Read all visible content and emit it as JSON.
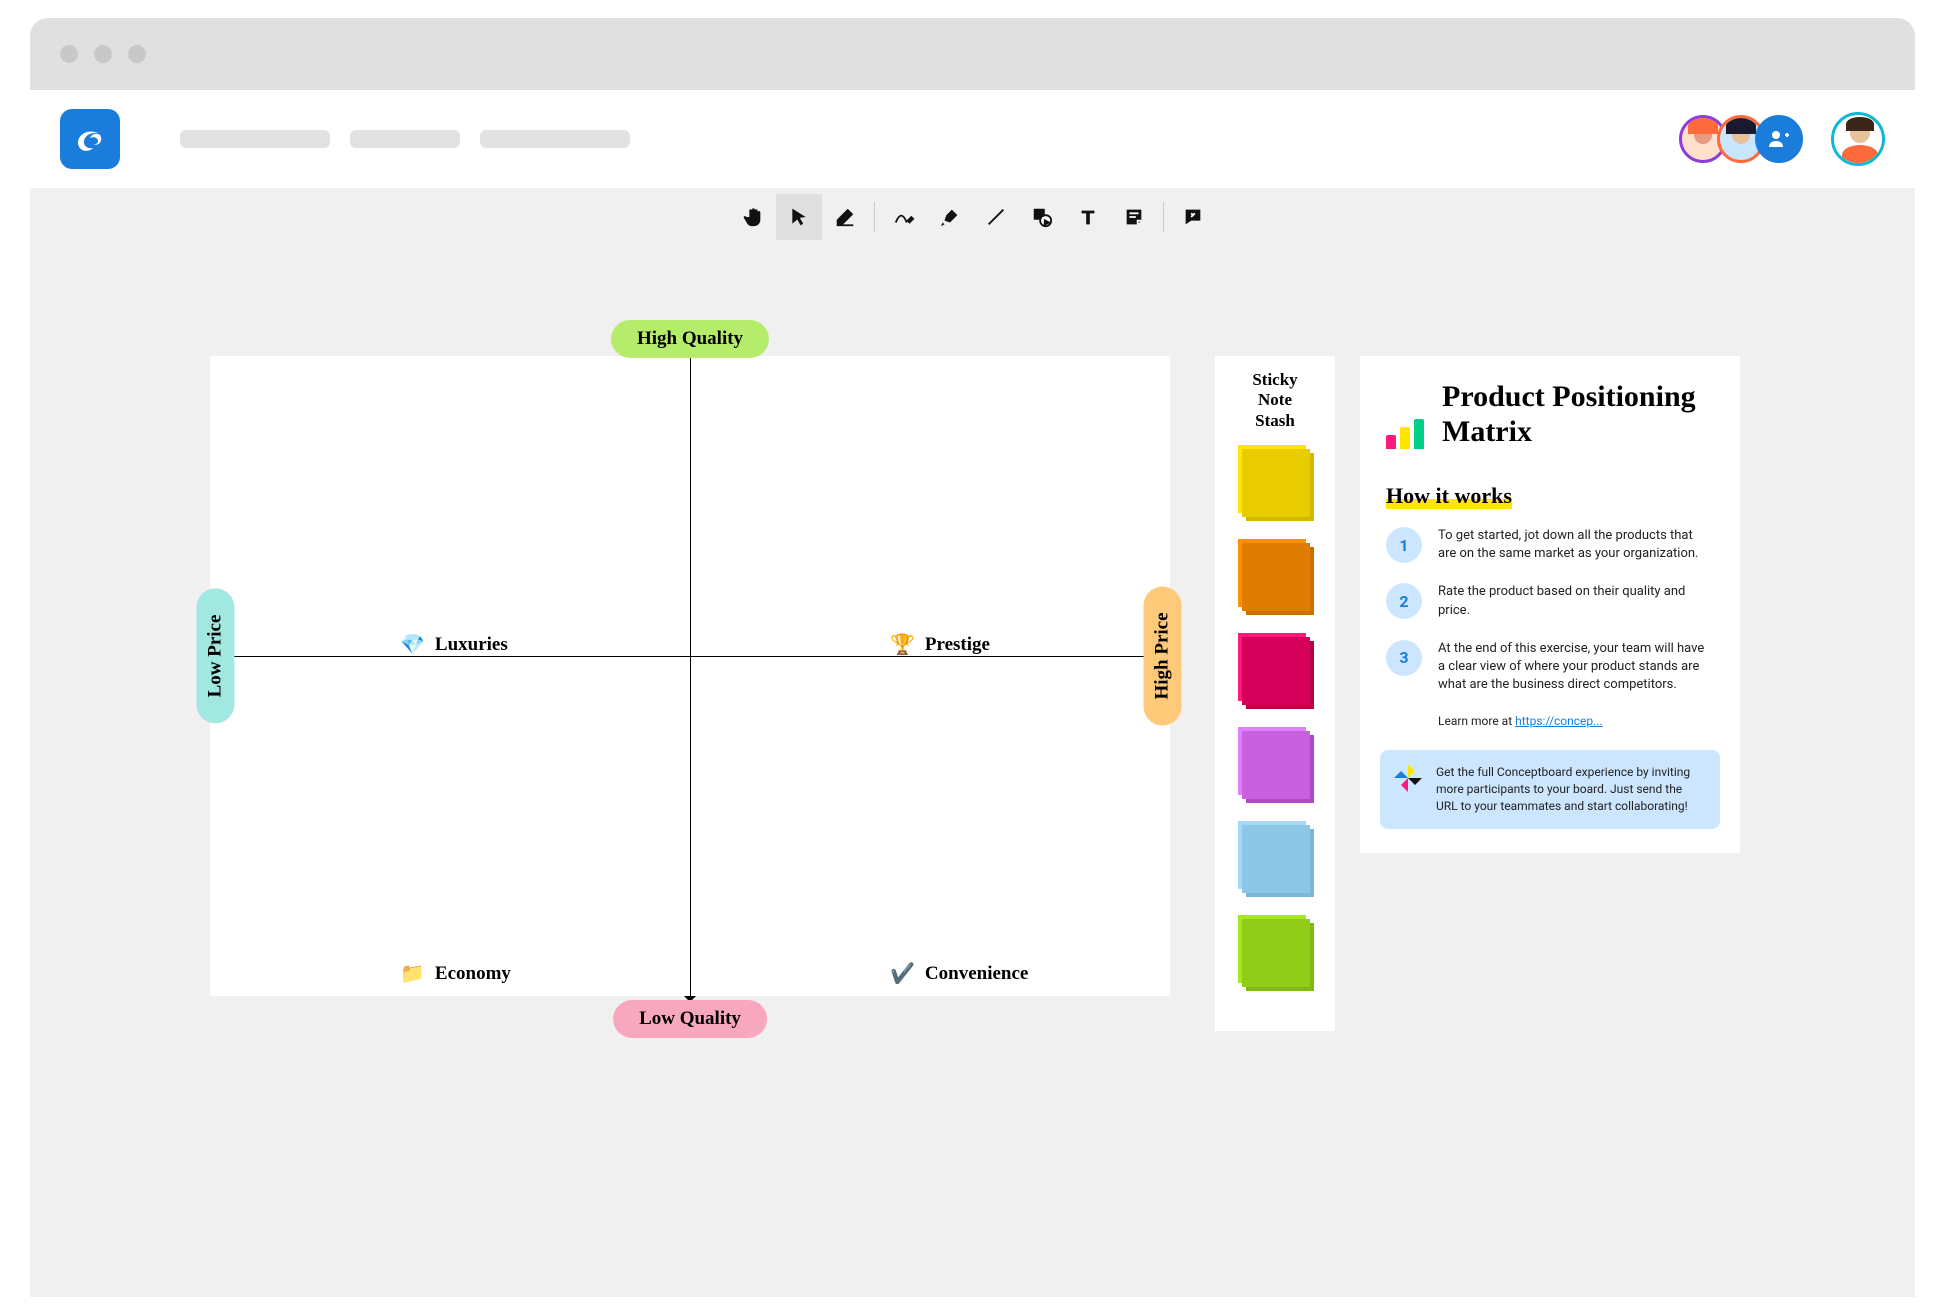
{
  "matrix": {
    "axis_top": "High Quality",
    "axis_bottom": "Low Quality",
    "axis_left": "Low Price",
    "axis_right": "High Price",
    "quadrants": {
      "top_left": {
        "icon": "💎",
        "label": "Luxuries"
      },
      "top_right": {
        "icon": "🏆",
        "label": "Prestige"
      },
      "bottom_left": {
        "icon": "📁",
        "label": "Economy"
      },
      "bottom_right": {
        "icon": "✔️",
        "label": "Convenience"
      }
    }
  },
  "sticky": {
    "title_l1": "Sticky",
    "title_l2": "Note",
    "title_l3": "Stash"
  },
  "info": {
    "title": "Product Positioning Matrix",
    "how_title": "How it works",
    "steps": {
      "s1_num": "1",
      "s1_text": "To get started, jot down all the products that are on the same market as your organization.",
      "s2_num": "2",
      "s2_text": "Rate the product based on their quality and price.",
      "s3_num": "3",
      "s3_text": "At the end of this exercise, your team will have a clear view of where your product stands are what are the business direct competitors."
    },
    "learn_more_prefix": "Learn more at ",
    "learn_more_link": "https://concep...",
    "promo": "Get the full Conceptboard experience by inviting more participants to your board. Just send the URL to your teammates and start collaborating!"
  }
}
